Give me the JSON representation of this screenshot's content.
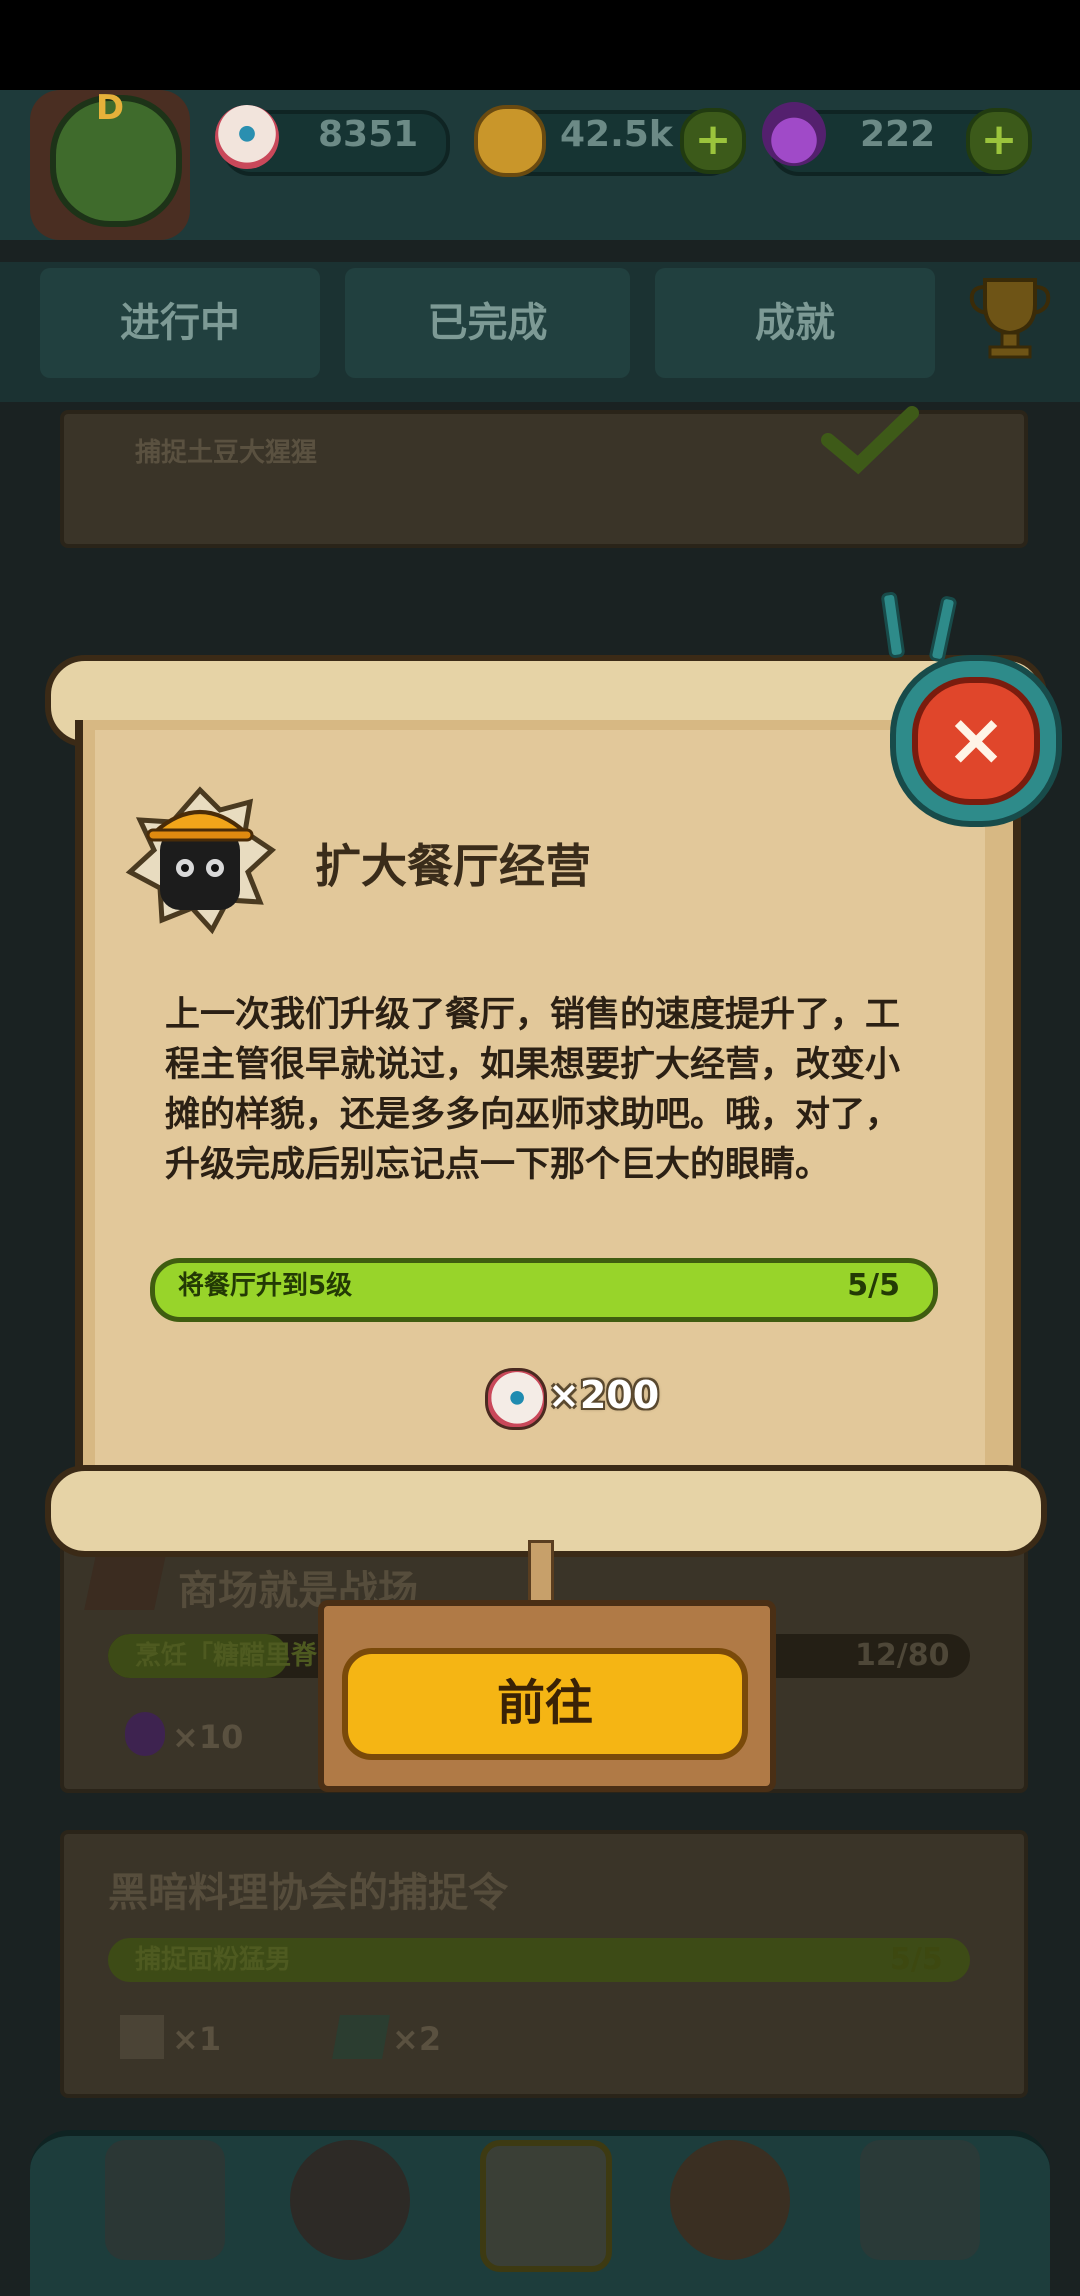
{
  "resources": {
    "eyeball": {
      "value": "8351",
      "icon": "eyeball-icon"
    },
    "coin": {
      "value": "42.5k",
      "icon": "coin-icon"
    },
    "potion": {
      "value": "222",
      "icon": "potion-icon"
    },
    "plus": "+"
  },
  "avatar": {
    "level_letter": "D"
  },
  "tabs": [
    {
      "label": "进行中"
    },
    {
      "label": "已完成"
    },
    {
      "label": "成就"
    }
  ],
  "background_list": {
    "item0": {
      "subtitle": "捕捉土豆大猩猩"
    },
    "item1": {
      "title": "商场就是战场",
      "task": "烹饪「糖醋里脊",
      "progress": "12/80",
      "reward": "×10"
    },
    "item2": {
      "title": "黑暗料理协会的捕捉令",
      "task": "捕捉面粉猛男",
      "progress": "5/5",
      "reward1": "×1",
      "reward2": "×2"
    }
  },
  "modal": {
    "title": "扩大餐厅经营",
    "description": "上一次我们升级了餐厅，销售的速度提升了，工程主管很早就说过，如果想要扩大经营，改变小摊的样貌，还是多多向巫师求助吧。哦，对了，升级完成后别忘记点一下那个巨大的眼睛。",
    "task_label": "将餐厅升到5级",
    "task_progress": "5/5",
    "progress_fraction": 1.0,
    "reward_amount": "×200",
    "go_button": "前往",
    "close_symbol": "×"
  },
  "colors": {
    "accent_green": "#98d42a",
    "button_yellow": "#f5b514",
    "close_red": "#e0462b",
    "paper": "#e2c89a"
  }
}
